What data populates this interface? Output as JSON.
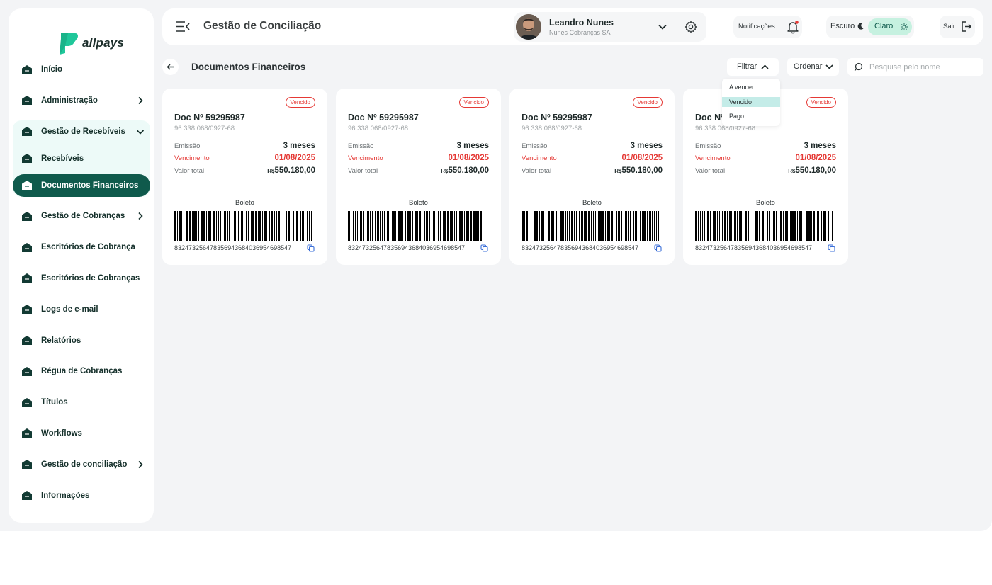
{
  "brand": {
    "name": "allpays",
    "accent": "#0f5a4c",
    "logo_color": "#1fc79a"
  },
  "sidebar": {
    "items": [
      {
        "label": "Início",
        "chevron": ""
      },
      {
        "label": "Administração",
        "chevron": "right"
      },
      {
        "label": "Gestão de Recebíveis",
        "chevron": "down"
      },
      {
        "label": "Recebíveis",
        "chevron": ""
      },
      {
        "label": "Documentos Financeiros",
        "chevron": "",
        "active": true
      },
      {
        "label": "Gestão de Cobranças",
        "chevron": "right"
      },
      {
        "label": "Escritórios de Cobrança",
        "chevron": ""
      },
      {
        "label": "Escritórios de Cobranças",
        "chevron": ""
      },
      {
        "label": "Logs de e-mail",
        "chevron": ""
      },
      {
        "label": "Relatórios",
        "chevron": ""
      },
      {
        "label": "Régua de Cobranças",
        "chevron": ""
      },
      {
        "label": "Títulos",
        "chevron": ""
      },
      {
        "label": "Workflows",
        "chevron": ""
      },
      {
        "label": "Gestão de conciliação",
        "chevron": "right"
      },
      {
        "label": "Informações",
        "chevron": ""
      }
    ]
  },
  "header": {
    "title": "Gestão de Conciliação",
    "user": {
      "name": "Leandro Nunes",
      "company": "Nunes Cobranças SA"
    },
    "notifications_label": "Notificações",
    "theme_dark_label": "Escuro",
    "theme_light_label": "Claro",
    "logout_label": "Sair"
  },
  "toolbar": {
    "title": "Documentos Financeiros",
    "filter_label": "Filtrar",
    "order_label": "Ordenar",
    "search_placeholder": "Pesquise pelo nome"
  },
  "filter_menu": {
    "options": [
      "A vencer",
      "Vencido",
      "Pago"
    ],
    "selected": "Vencido"
  },
  "cards": [
    {
      "status": "Vencido",
      "title": "Doc Nº 59295987",
      "doc_id": "96.338.068/0927-68",
      "emissao_label": "Emissão",
      "emissao": "3 meses",
      "vencimento_label": "Vencimento",
      "vencimento": "01/08/2025",
      "valor_label": "Valor total",
      "currency": "R$",
      "valor": "550.180,00",
      "boleto_label": "Boleto",
      "barcode_number": "832473256478356943684036954698547"
    },
    {
      "status": "Vencido",
      "title": "Doc Nº 59295987",
      "doc_id": "96.338.068/0927-68",
      "emissao_label": "Emissão",
      "emissao": "3 meses",
      "vencimento_label": "Vencimento",
      "vencimento": "01/08/2025",
      "valor_label": "Valor total",
      "currency": "R$",
      "valor": "550.180,00",
      "boleto_label": "Boleto",
      "barcode_number": "832473256478356943684036954698547"
    },
    {
      "status": "Vencido",
      "title": "Doc Nº 59295987",
      "doc_id": "96.338.068/0927-68",
      "emissao_label": "Emissão",
      "emissao": "3 meses",
      "vencimento_label": "Vencimento",
      "vencimento": "01/08/2025",
      "valor_label": "Valor total",
      "currency": "R$",
      "valor": "550.180,00",
      "boleto_label": "Boleto",
      "barcode_number": "832473256478356943684036954698547"
    },
    {
      "status": "Vencido",
      "title": "Doc Nº 59295987",
      "doc_id": "96.338.068/0927-68",
      "emissao_label": "Emissão",
      "emissao": "3 meses",
      "vencimento_label": "Vencimento",
      "vencimento": "01/08/2025",
      "valor_label": "Valor total",
      "currency": "R$",
      "valor": "550.180,00",
      "boleto_label": "Boleto",
      "barcode_number": "832473256478356943684036954698547"
    }
  ],
  "colors": {
    "overdue": "#e53935",
    "active_nav": "#0f5a4c",
    "group_bg": "#edfaf8",
    "selected_option": "#c4ece8"
  }
}
